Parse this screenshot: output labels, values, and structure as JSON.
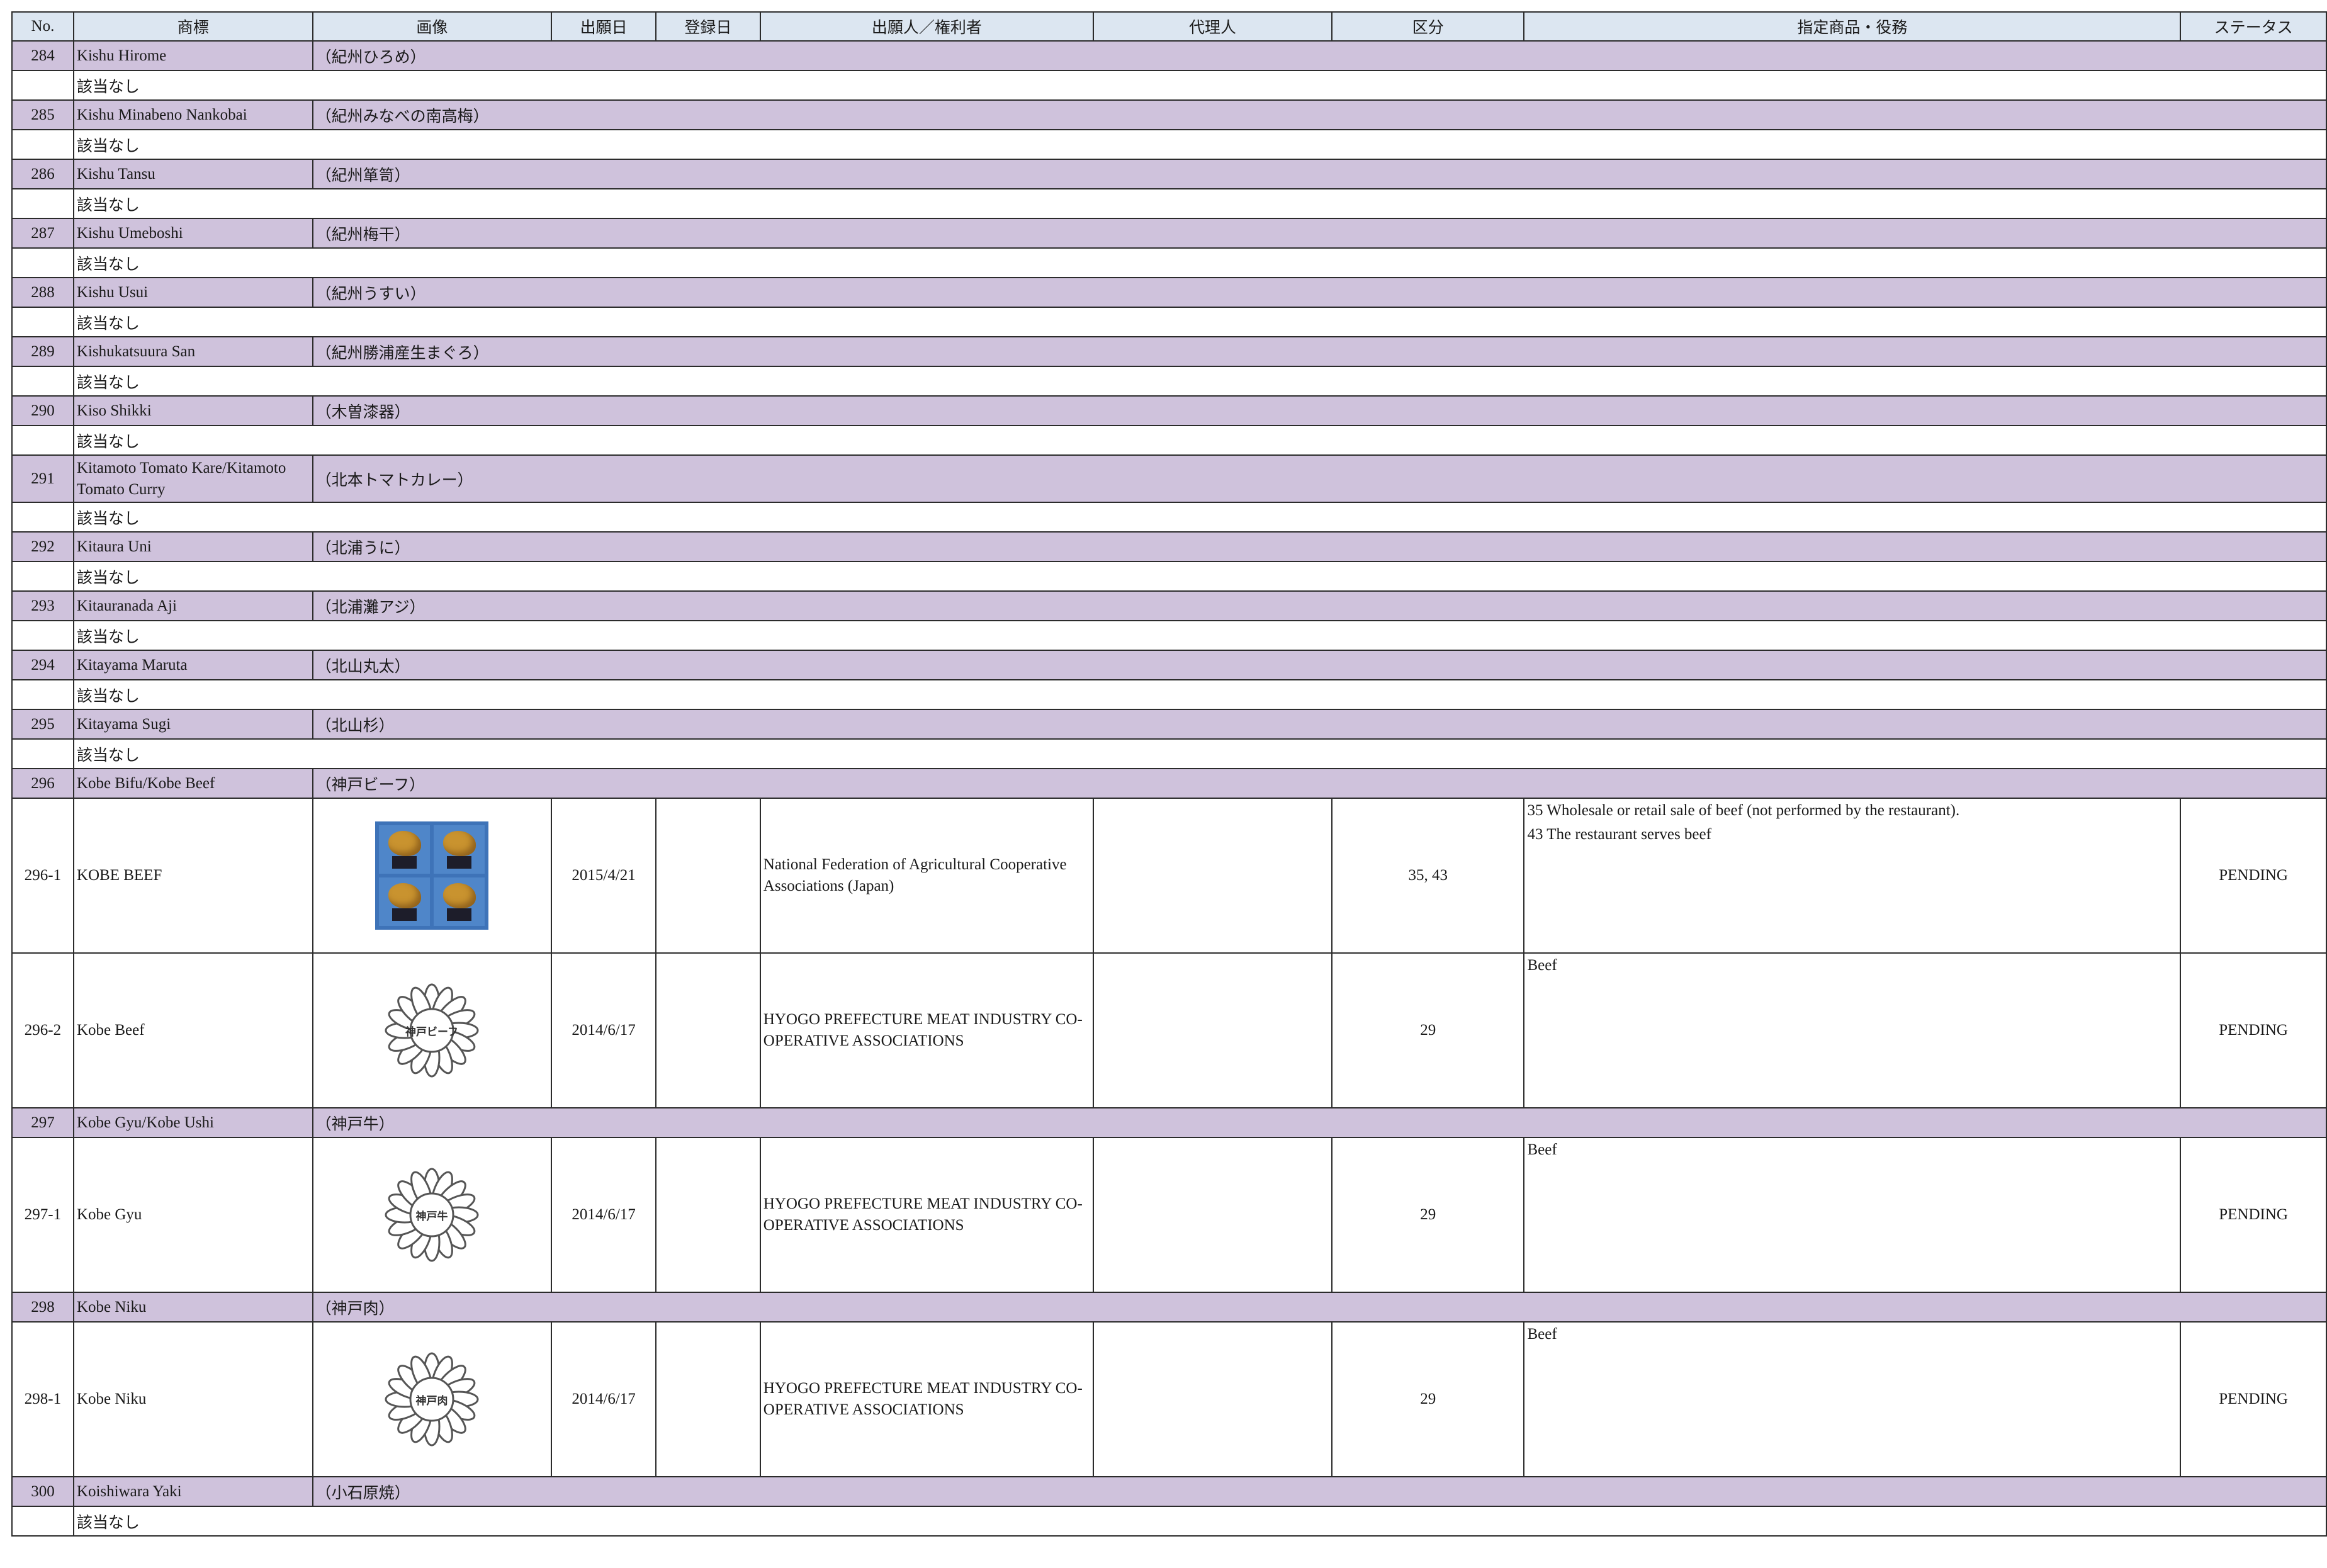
{
  "headers": [
    "No.",
    "商標",
    "画像",
    "出願日",
    "登録日",
    "出願人／権利者",
    "代理人",
    "区分",
    "指定商品・役務",
    "ステータス"
  ],
  "rows": [
    {
      "kind": "grp",
      "no": "284",
      "name": "Kishu Hirome",
      "jp": "（紀州ひろめ）"
    },
    {
      "kind": "nil",
      "text": "該当なし"
    },
    {
      "kind": "grp",
      "no": "285",
      "name": "Kishu Minabeno Nankobai",
      "jp": "（紀州みなべの南高梅）"
    },
    {
      "kind": "nil",
      "text": "該当なし"
    },
    {
      "kind": "grp",
      "no": "286",
      "name": "Kishu Tansu",
      "jp": "（紀州箪笥）"
    },
    {
      "kind": "nil",
      "text": "該当なし"
    },
    {
      "kind": "grp",
      "no": "287",
      "name": "Kishu Umeboshi",
      "jp": "（紀州梅干）"
    },
    {
      "kind": "nil",
      "text": "該当なし"
    },
    {
      "kind": "grp",
      "no": "288",
      "name": "Kishu Usui",
      "jp": "（紀州うすい）"
    },
    {
      "kind": "nil",
      "text": "該当なし"
    },
    {
      "kind": "grp",
      "no": "289",
      "name": "Kishukatsuura San",
      "jp": "（紀州勝浦産生まぐろ）"
    },
    {
      "kind": "nil",
      "text": "該当なし"
    },
    {
      "kind": "grp",
      "no": "290",
      "name": "Kiso Shikki",
      "jp": "（木曽漆器）"
    },
    {
      "kind": "nil",
      "text": "該当なし"
    },
    {
      "kind": "grp",
      "no": "291",
      "name": "Kitamoto Tomato Kare/Kitamoto Tomato Curry",
      "jp": "（北本トマトカレー）",
      "tall": true
    },
    {
      "kind": "nil",
      "text": "該当なし"
    },
    {
      "kind": "grp",
      "no": "292",
      "name": "Kitaura Uni",
      "jp": "（北浦うに）"
    },
    {
      "kind": "nil",
      "text": "該当なし"
    },
    {
      "kind": "grp",
      "no": "293",
      "name": "Kitauranada Aji",
      "jp": "（北浦灘アジ）"
    },
    {
      "kind": "nil",
      "text": "該当なし"
    },
    {
      "kind": "grp",
      "no": "294",
      "name": "Kitayama Maruta",
      "jp": "（北山丸太）"
    },
    {
      "kind": "nil",
      "text": "該当なし"
    },
    {
      "kind": "grp",
      "no": "295",
      "name": "Kitayama Sugi",
      "jp": "（北山杉）"
    },
    {
      "kind": "nil",
      "text": "該当なし"
    },
    {
      "kind": "grp",
      "no": "296",
      "name": "Kobe Bifu/Kobe Beef",
      "jp": "（神戸ビーフ）"
    },
    {
      "kind": "det",
      "no": "296-1",
      "name": "KOBE BEEF",
      "image": "photo-grid",
      "filed": "2015/4/21",
      "registered": "",
      "applicant": "National Federation of Agricultural Cooperative Associations (Japan)",
      "agent": "",
      "classes": "35, 43",
      "goods": [
        "35  Wholesale or retail sale of beef (not performed by the restaurant).",
        "43 The restaurant serves beef"
      ],
      "status": "PENDING"
    },
    {
      "kind": "det",
      "no": "296-2",
      "name": "Kobe Beef",
      "image": "flower",
      "mark_text": "神戸ビーフ",
      "filed": "2014/6/17",
      "registered": "",
      "applicant": "HYOGO PREFECTURE MEAT INDUSTRY CO-OPERATIVE ASSOCIATIONS",
      "agent": "",
      "classes": "29",
      "goods": [
        "Beef"
      ],
      "status": "PENDING"
    },
    {
      "kind": "grp",
      "no": "297",
      "name": "Kobe Gyu/Kobe Ushi",
      "jp": "（神戸牛）"
    },
    {
      "kind": "det",
      "no": "297-1",
      "name": "Kobe Gyu",
      "image": "flower",
      "mark_text": "神戸牛",
      "filed": "2014/6/17",
      "registered": "",
      "applicant": "HYOGO PREFECTURE MEAT INDUSTRY CO-OPERATIVE ASSOCIATIONS",
      "agent": "",
      "classes": "29",
      "goods": [
        "Beef"
      ],
      "status": "PENDING"
    },
    {
      "kind": "grp",
      "no": "298",
      "name": "Kobe Niku",
      "jp": "（神戸肉）"
    },
    {
      "kind": "det",
      "no": "298-1",
      "name": "Kobe Niku",
      "image": "flower",
      "mark_text": "神戸肉",
      "filed": "2014/6/17",
      "registered": "",
      "applicant": "HYOGO PREFECTURE MEAT INDUSTRY CO-OPERATIVE ASSOCIATIONS",
      "agent": "",
      "classes": "29",
      "goods": [
        "Beef"
      ],
      "status": "PENDING"
    },
    {
      "kind": "grp",
      "no": "300",
      "name": "Koishiwara Yaki",
      "jp": "（小石原焼）"
    },
    {
      "kind": "nil",
      "text": "該当なし"
    }
  ],
  "colors": {
    "header_bg": "#dce6f1",
    "group_bg": "#cfc2dc",
    "border": "#2b2b2b",
    "photo_bg": "#3e73b8",
    "photo_item": "#c9932f"
  }
}
